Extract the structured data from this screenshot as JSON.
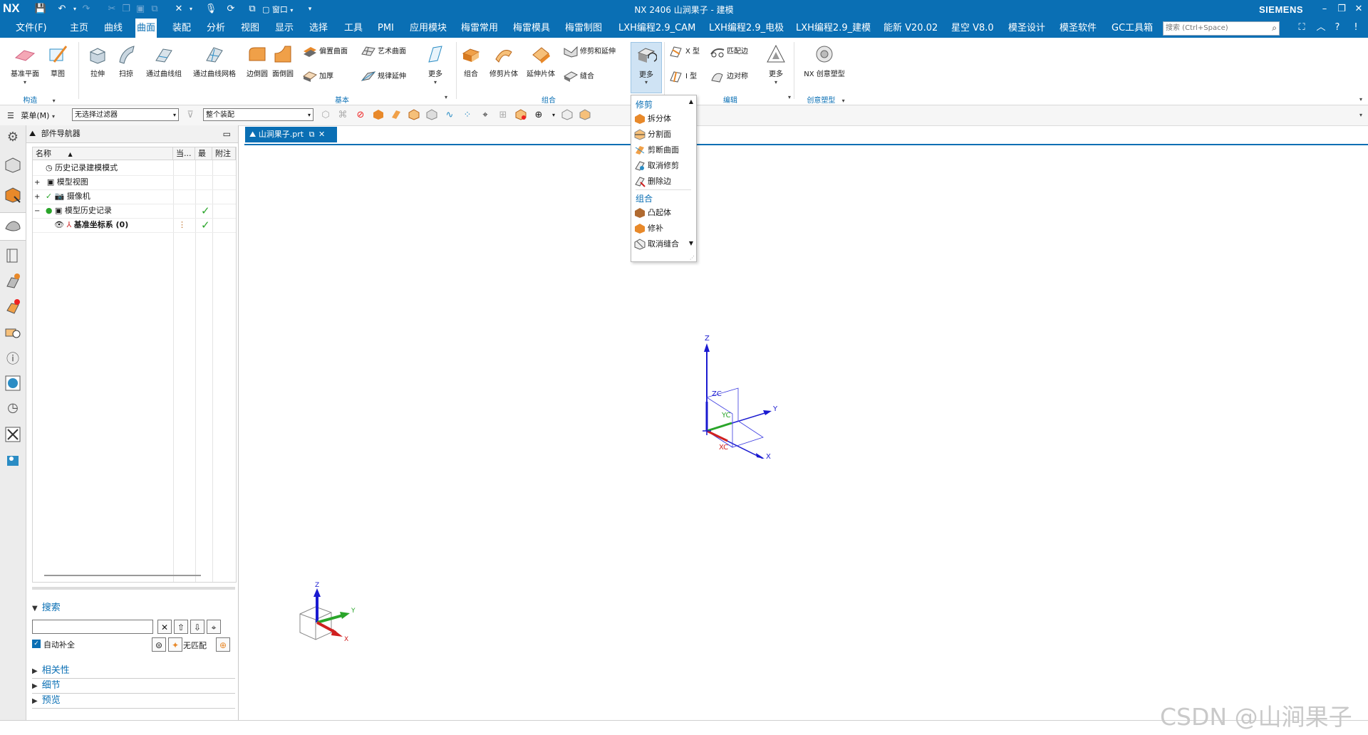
{
  "app": {
    "logo": "NX",
    "window_title": "NX 2406 山涧果子 - 建模",
    "brand": "SIEMENS",
    "quick_window_label": "窗口"
  },
  "menu": {
    "file": "文件(F)",
    "tabs": [
      "主页",
      "曲线",
      "曲面",
      "装配",
      "分析",
      "视图",
      "显示",
      "选择",
      "工具",
      "PMI",
      "应用模块",
      "梅雷常用",
      "梅雷模具",
      "梅雷制图",
      "LXH编程2.9_CAM",
      "LXH编程2.9_电极",
      "LXH编程2.9_建模",
      "能新 V20.02",
      "星空 V8.0",
      "模圣设计",
      "模圣软件",
      "GC工具箱"
    ],
    "active_tab": "曲面",
    "search_placeholder": "搜索 (Ctrl+Space)"
  },
  "ribbon": {
    "construct": {
      "group_label": "构造",
      "datum_plane": "基准平面",
      "sketch": "草图"
    },
    "basic": {
      "group_label": "基本",
      "extrude": "拉伸",
      "sweep": "扫掠",
      "through_curves": "通过曲线组",
      "through_curve_mesh": "通过曲线网格",
      "edge_blend": "边倒圆",
      "face_blend": "面倒圆",
      "offset_surface": "偏置曲面",
      "thicken": "加厚",
      "studio_surface": "艺术曲面",
      "law_extension": "规律延伸",
      "more": "更多"
    },
    "combine": {
      "group_label": "组合",
      "unite": "组合",
      "trim_sheet": "修剪片体",
      "extend_sheet": "延伸片体",
      "trim_extend": "修剪和延伸",
      "sew": "缝合",
      "more": "更多"
    },
    "edit": {
      "group_label": "编辑",
      "x_form": "X 型",
      "i_form": "I 型",
      "match_edge": "匹配边",
      "edge_symmetry": "边对称",
      "more": "更多"
    },
    "nx_realize": {
      "group_label": "创意塑型",
      "label": "NX 创意塑型"
    }
  },
  "selection_bar": {
    "menu": "菜单(M)",
    "type_filter": "无选择过滤器",
    "scope": "整个装配"
  },
  "navigator": {
    "title": "部件导航器",
    "columns": [
      "名称",
      "当...",
      "最",
      "附注"
    ],
    "rows": [
      {
        "label": "历史记录建模模式",
        "check": ""
      },
      {
        "label": "模型视图",
        "check": ""
      },
      {
        "label": "摄像机",
        "check": ""
      },
      {
        "label": "模型历史记录",
        "check": "✓"
      },
      {
        "label": "基准坐标系 (0)",
        "check": "✓"
      }
    ],
    "search": {
      "header": "搜索",
      "auto_complete": "自动补全",
      "no_match": "无匹配"
    },
    "sections": [
      "相关性",
      "细节",
      "预览"
    ]
  },
  "document": {
    "tab": "山涧果子.prt"
  },
  "dropdown": {
    "trim_header": "修剪",
    "trim_items": [
      "拆分体",
      "分割面",
      "剪断曲面",
      "取消修剪",
      "删除边"
    ],
    "combine_header": "组合",
    "combine_items": [
      "凸起体",
      "修补",
      "取消缝合"
    ]
  },
  "triad": {
    "labels": {
      "z": "Z",
      "y": "Y",
      "x": "X",
      "zc": "ZC",
      "yc": "YC",
      "xc": "XC"
    }
  },
  "watermark": "CSDN @山涧果子",
  "colors": {
    "title_bar": "#0a6fb4",
    "accent_orange": "#e8892a",
    "check_green": "#2aa52a"
  }
}
